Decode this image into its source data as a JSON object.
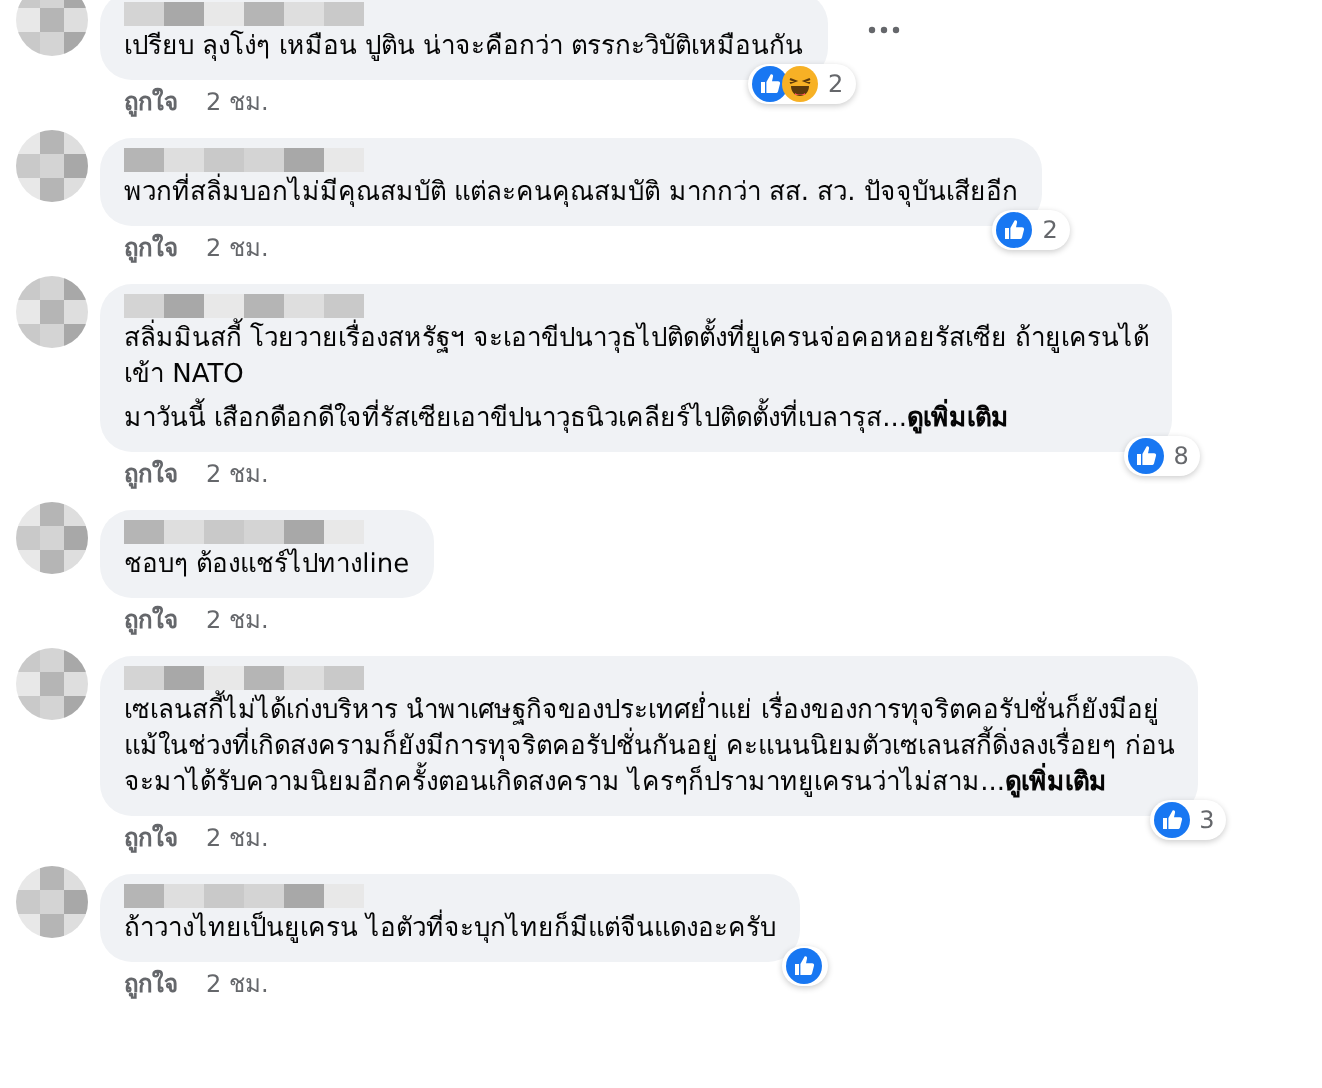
{
  "comments": [
    {
      "paragraphs": [
        "เปรียบ ลุงโง่ๆ เหมือน ปูติน น่าจะคือกว่า ตรรกะวิบัติเหมือนกัน"
      ],
      "more_menu": true,
      "reactions": {
        "like": true,
        "haha": true,
        "count": "2"
      },
      "actions": {
        "like": "ถูกใจ",
        "time": "2 ชม."
      }
    },
    {
      "paragraphs": [
        "พวกที่สลิ่มบอกไม่มีคุณสมบัติ แต่ละคนคุณสมบัติ มากกว่า สส. สว. ปัจจุบันเสียอีก"
      ],
      "reactions": {
        "like": true,
        "count": "2"
      },
      "actions": {
        "like": "ถูกใจ",
        "time": "2 ชม."
      }
    },
    {
      "paragraphs": [
        "สลิ่มมินสกี้ โวยวายเรื่องสหรัฐฯ จะเอาขีปนาวุธไปติดตั้งที่ยูเครนจ่อคอหอยรัสเซีย ถ้ายูเครนได้\nเข้า NATO",
        "มาวันนี้ เสือกดือกดีใจที่รัสเซียเอาขีปนาวุธนิวเคลียร์ไปติดตั้งที่เบลารุส..."
      ],
      "see_more": "ดูเพิ่มเติม",
      "reactions": {
        "like": true,
        "count": "8"
      },
      "actions": {
        "like": "ถูกใจ",
        "time": "2 ชม."
      }
    },
    {
      "paragraphs": [
        "ชอบๆ ต้องแชร์ไปทางline"
      ],
      "actions": {
        "like": "ถูกใจ",
        "time": "2 ชม."
      }
    },
    {
      "paragraphs": [
        "เซเลนสกี้ไม่ได้เก่งบริหาร นำพาเศษฐกิจของประเทศย่ำแย่ เรื่องของการทุจริตคอรัปชั่นก็ยังมีอยู่\nแม้ในช่วงที่เกิดสงครามก็ยังมีการทุจริตคอรัปชั่นกันอยู่ คะแนนนิยมตัวเซเลนสกี้ดิ่งลงเรื่อยๆ ก่อน\nจะมาได้รับความนิยมอีกครั้งตอนเกิดสงคราม ไครๆก็ปรามาทยูเครนว่าไม่สาม..."
      ],
      "see_more": "ดูเพิ่มเติม",
      "reactions": {
        "like": true,
        "count": "3"
      },
      "actions": {
        "like": "ถูกใจ",
        "time": "2 ชม."
      }
    },
    {
      "paragraphs": [
        "ถ้าวางไทยเป็นยูเครน ไอตัวที่จะบุกไทยก็มีแต่จีนแดงอะครับ"
      ],
      "reactions": {
        "like": true
      },
      "actions": {
        "like": "ถูกใจ",
        "time": "2 ชม."
      }
    }
  ]
}
